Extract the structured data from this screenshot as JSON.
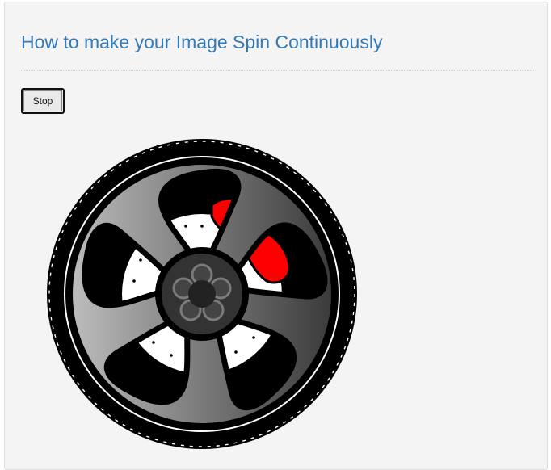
{
  "page": {
    "title": "How to make your Image Spin Continuously"
  },
  "controls": {
    "stop_label": "Stop"
  },
  "image": {
    "icon": "spinning-wheel-icon",
    "spinning": true
  },
  "colors": {
    "title": "#337ab7",
    "panel_background": "#f4f4f4",
    "caliper": "#ff0000"
  }
}
